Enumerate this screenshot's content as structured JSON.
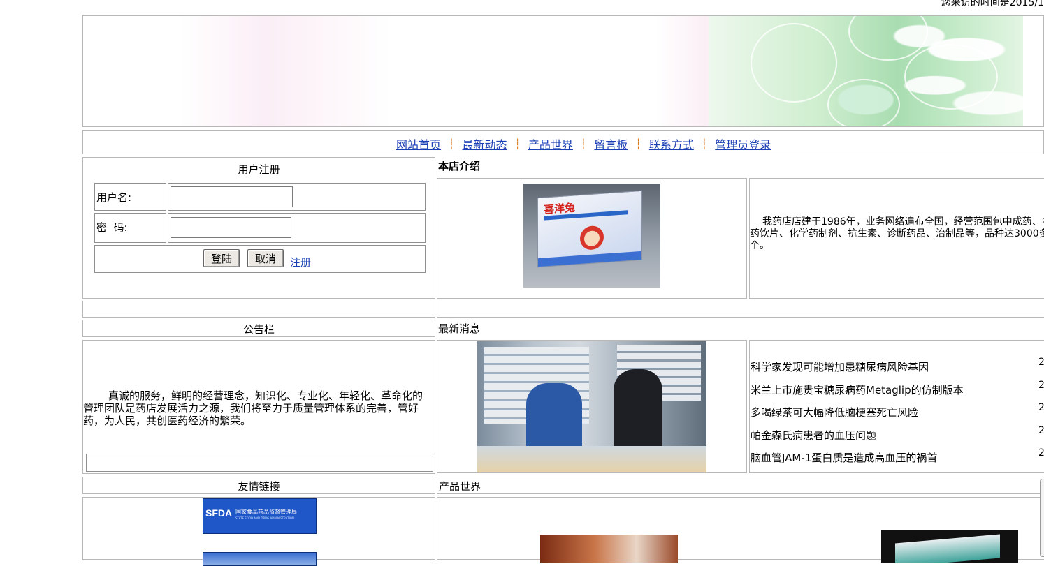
{
  "top_bar": {
    "visit_text": "您来访的时间是2015/1"
  },
  "nav": {
    "items": [
      {
        "label": "网站首页"
      },
      {
        "label": "最新动态"
      },
      {
        "label": "产品世界"
      },
      {
        "label": "留言板"
      },
      {
        "label": "联系方式"
      },
      {
        "label": "管理员登录"
      }
    ],
    "separator": "┆"
  },
  "register": {
    "title": "用户注册",
    "username_label": "用户名:",
    "username_value": "",
    "password_label": "密  码:",
    "password_value": "",
    "login_button": "登陆",
    "cancel_button": "取消",
    "register_link": "注册"
  },
  "intro": {
    "title": "本店介绍",
    "product_box_text": "喜洋兔",
    "text": "我药店店建于1986年，业务网络遍布全国，经营范围包中成药、中药饮片、化学药制剂、抗生素、诊断药品、治制品等，品种达3000多个。"
  },
  "notice": {
    "title": "公告栏",
    "text": "真诚的服务，鲜明的经营理念，知识化、专业化、年轻化、革命化的管理团队是药店发展活力之源，我们将至力于质量管理体系的完善，管好药，为人民，共创医药经济的繁荣。"
  },
  "news": {
    "title": "最新消息",
    "items": [
      {
        "title": "科学家发现可能增加患糖尿病风险基因",
        "date": "2"
      },
      {
        "title": "米兰上市施贵宝糖尿病药Metaglip的仿制版本",
        "date": "2"
      },
      {
        "title": "多喝绿茶可大幅降低脑梗塞死亡风险",
        "date": "2"
      },
      {
        "title": "帕金森氏病患者的血压问题",
        "date": "2"
      },
      {
        "title": "脑血管JAM-1蛋白质是造成高血压的祸首",
        "date": "2"
      }
    ]
  },
  "links": {
    "title": "友情链接",
    "sfda_abbr": "SFDA",
    "sfda_name": "国家食品药品监督管理局",
    "sfda_name_en": "STATE FOOD AND DRUG ADMINISTRATION"
  },
  "products": {
    "title": "产品世界"
  },
  "colors": {
    "link": "#1a3fb5",
    "separator": "#e07b20",
    "border": "#b8b8b8",
    "sfda_blue": "#1f56c8"
  }
}
